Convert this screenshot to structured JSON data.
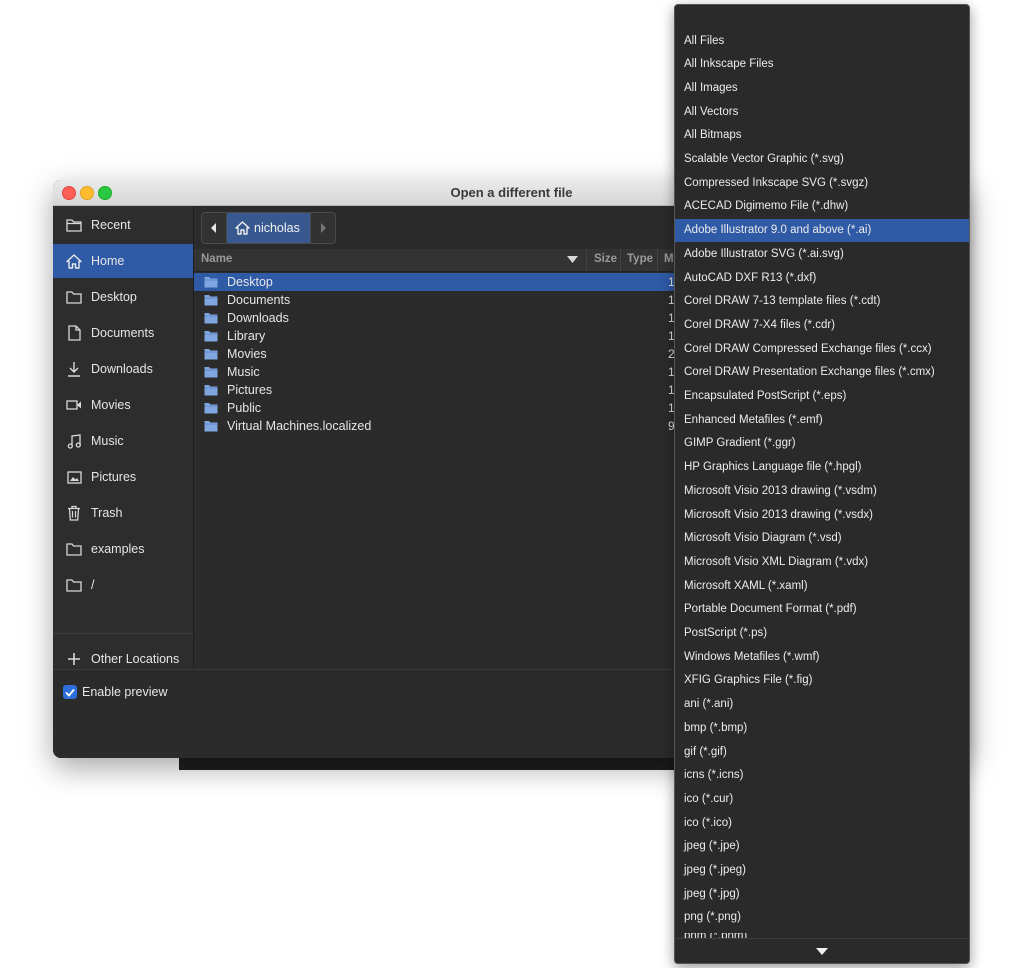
{
  "window": {
    "title": "Open a different file"
  },
  "sidebar": {
    "items": [
      {
        "label": "Recent",
        "icon": "recent-icon"
      },
      {
        "label": "Home",
        "icon": "home-icon",
        "active": true
      },
      {
        "label": "Desktop",
        "icon": "folder-icon"
      },
      {
        "label": "Documents",
        "icon": "document-icon"
      },
      {
        "label": "Downloads",
        "icon": "download-icon"
      },
      {
        "label": "Movies",
        "icon": "movie-icon"
      },
      {
        "label": "Music",
        "icon": "music-icon"
      },
      {
        "label": "Pictures",
        "icon": "picture-icon"
      },
      {
        "label": "Trash",
        "icon": "trash-icon"
      },
      {
        "label": "examples",
        "icon": "folder-icon"
      },
      {
        "label": "/",
        "icon": "folder-icon"
      }
    ],
    "other_locations": "Other Locations"
  },
  "pathbar": {
    "current": "nicholas"
  },
  "columns": {
    "name": "Name",
    "size": "Size",
    "type": "Type",
    "modified": "M"
  },
  "files": [
    {
      "name": "Desktop",
      "modified": "1",
      "selected": true
    },
    {
      "name": "Documents",
      "modified": "1"
    },
    {
      "name": "Downloads",
      "modified": "1"
    },
    {
      "name": "Library",
      "modified": "1"
    },
    {
      "name": "Movies",
      "modified": "2"
    },
    {
      "name": "Music",
      "modified": "1"
    },
    {
      "name": "Pictures",
      "modified": "1"
    },
    {
      "name": "Public",
      "modified": "1"
    },
    {
      "name": "Virtual Machines.localized",
      "modified": "9"
    }
  ],
  "preview": {
    "label": "Enable preview",
    "checked": true
  },
  "filter_menu": {
    "selected": "Adobe Illustrator 9.0 and above (*.ai)",
    "items": [
      "All Files",
      "All Inkscape Files",
      "All Images",
      "All Vectors",
      "All Bitmaps",
      "Scalable Vector Graphic (*.svg)",
      "Compressed Inkscape SVG (*.svgz)",
      "ACECAD Digimemo File (*.dhw)",
      "Adobe Illustrator 9.0 and above (*.ai)",
      "Adobe Illustrator SVG (*.ai.svg)",
      "AutoCAD DXF R13 (*.dxf)",
      "Corel DRAW 7-13 template files (*.cdt)",
      "Corel DRAW 7-X4 files (*.cdr)",
      "Corel DRAW Compressed Exchange files (*.ccx)",
      "Corel DRAW Presentation Exchange files (*.cmx)",
      "Encapsulated PostScript (*.eps)",
      "Enhanced Metafiles (*.emf)",
      "GIMP Gradient (*.ggr)",
      "HP Graphics Language file (*.hpgl)",
      "Microsoft Visio 2013 drawing (*.vsdm)",
      "Microsoft Visio 2013 drawing (*.vsdx)",
      "Microsoft Visio Diagram (*.vsd)",
      "Microsoft Visio XML Diagram (*.vdx)",
      "Microsoft XAML (*.xaml)",
      "Portable Document Format (*.pdf)",
      "PostScript (*.ps)",
      "Windows Metafiles (*.wmf)",
      "XFIG Graphics File (*.fig)",
      "ani (*.ani)",
      "bmp (*.bmp)",
      "gif (*.gif)",
      "icns (*.icns)",
      "ico (*.cur)",
      "ico (*.ico)",
      "jpeg (*.jpe)",
      "jpeg (*.jpeg)",
      "jpeg (*.jpg)",
      "png (*.png)"
    ],
    "partial_item": "pnm (*.pnm)"
  },
  "colors": {
    "accent": "#2f5aa6",
    "folder": "#7fa6e0"
  }
}
